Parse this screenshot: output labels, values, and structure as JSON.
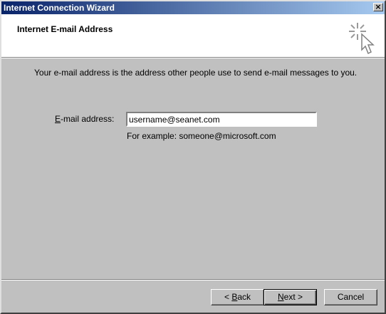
{
  "window": {
    "title": "Internet Connection Wizard",
    "close_glyph": "×"
  },
  "header": {
    "title": "Internet E-mail Address",
    "icon": "wizard-cursor-icon"
  },
  "content": {
    "intro": "Your e-mail address is the address other people use to send e-mail messages to you.",
    "email_label_accel": "E",
    "email_label_rest": "-mail address:",
    "email_value": "username@seanet.com",
    "example": "For example: someone@microsoft.com"
  },
  "buttons": {
    "back_prefix": "< ",
    "back_accel": "B",
    "back_rest": "ack",
    "next_accel": "N",
    "next_rest": "ext >",
    "cancel": "Cancel"
  },
  "colors": {
    "title_start": "#0a246a",
    "title_end": "#a6caf0",
    "dialog_bg": "#c0c0c0",
    "header_bg": "#ffffff"
  }
}
